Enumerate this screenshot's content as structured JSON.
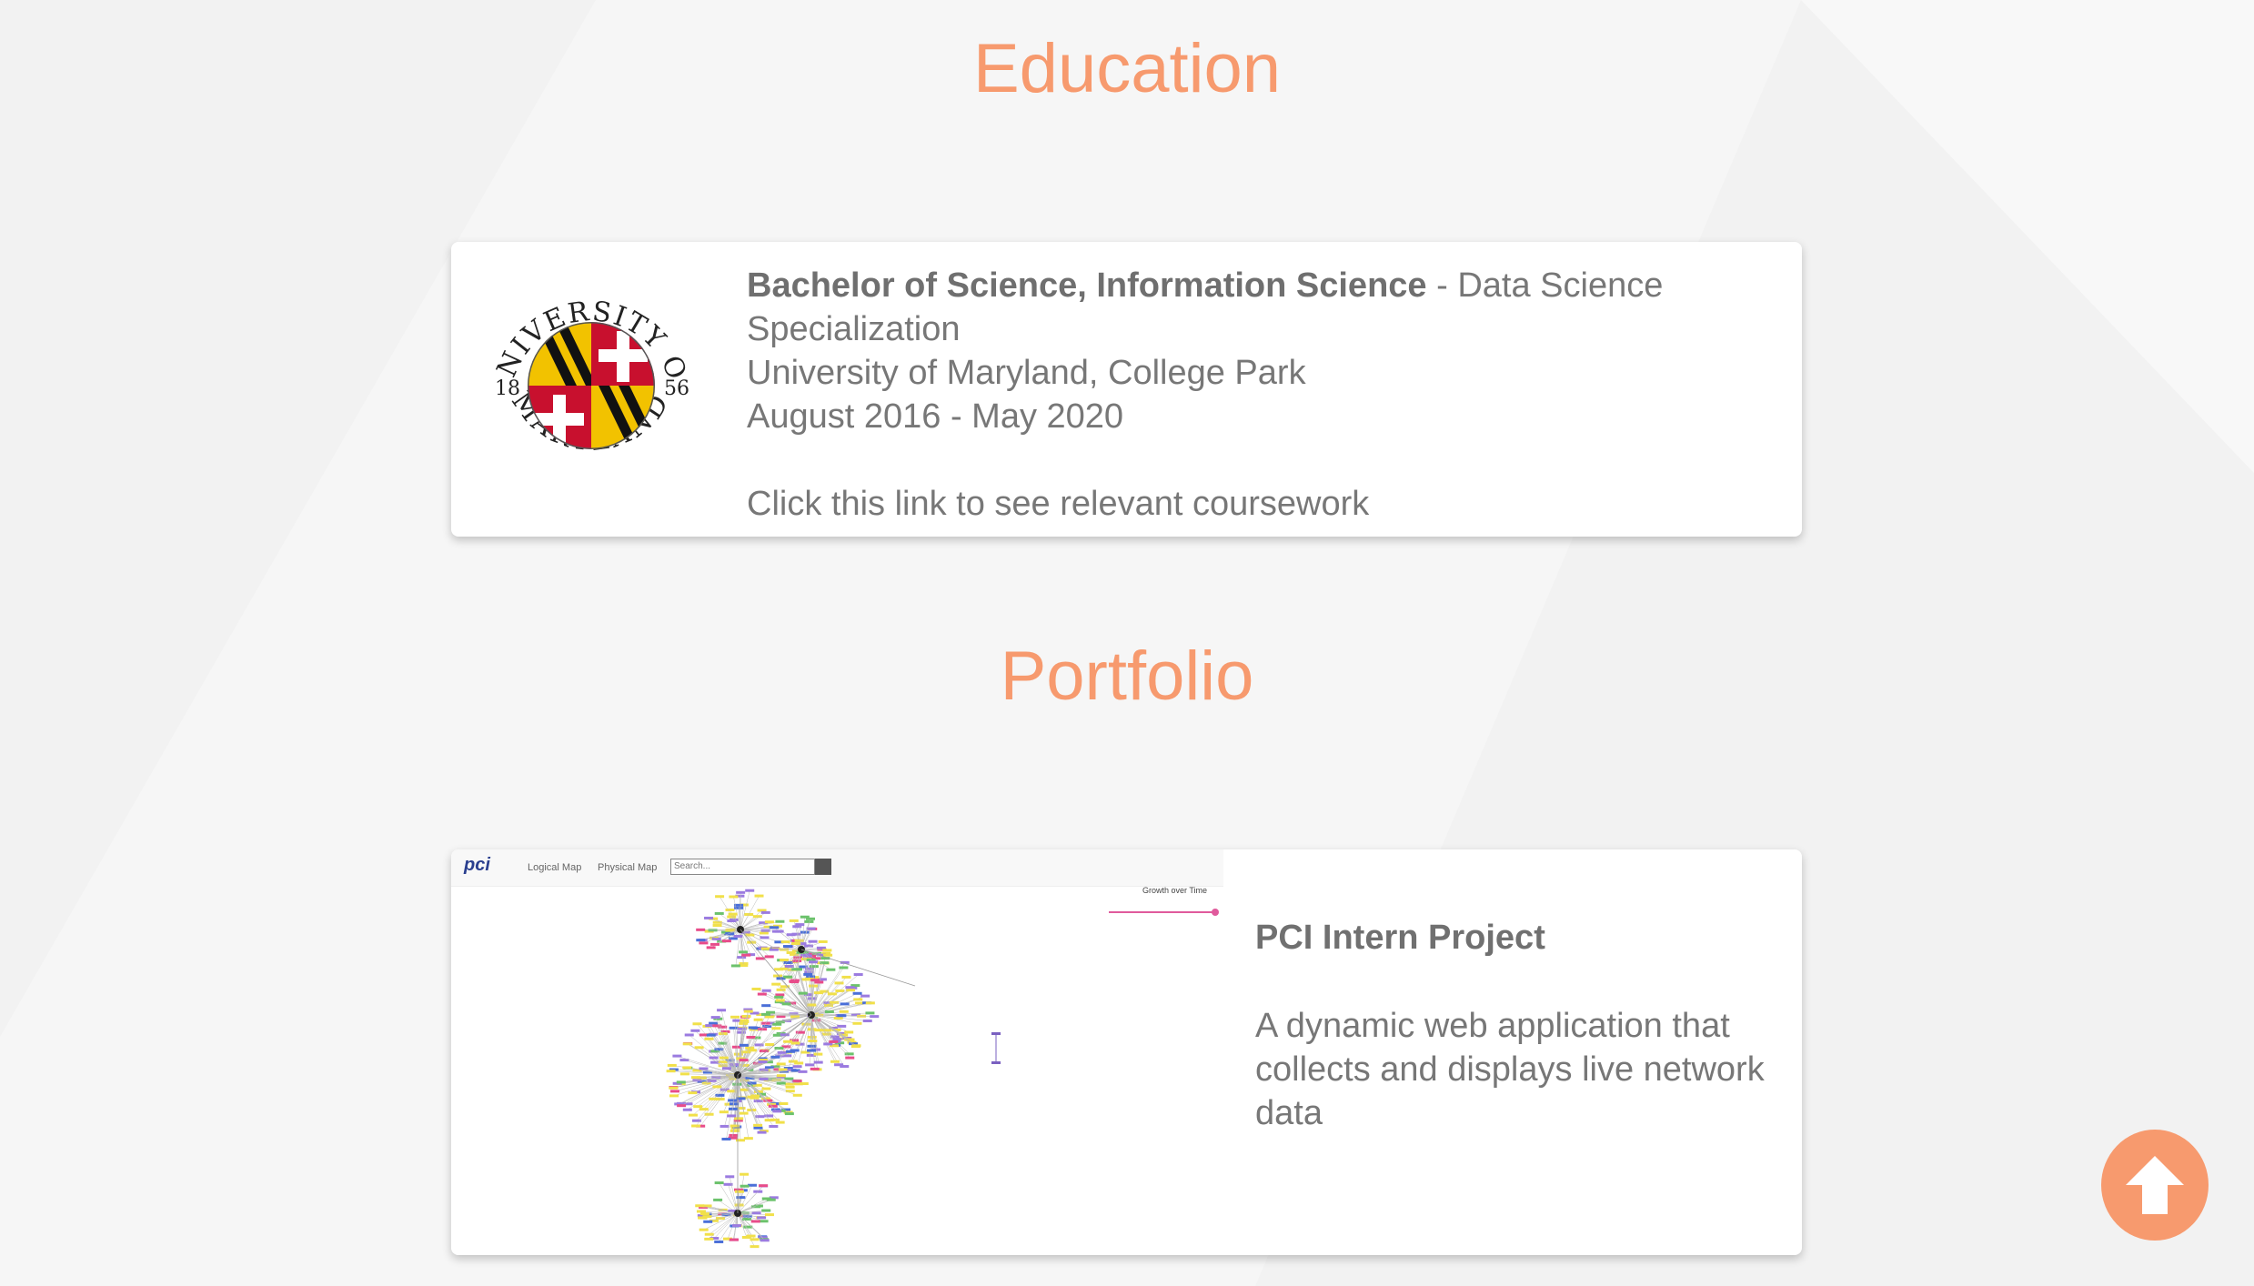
{
  "education": {
    "heading": "Education",
    "degree": "Bachelor of Science, Information Science",
    "specialization": " - Data Science Specialization",
    "school": "University of Maryland, College Park",
    "dates": "August 2016 - May 2020",
    "coursework_link": "Click this link to see relevant coursework",
    "logo": {
      "top_text": "UNIVERSITY OF",
      "bottom_text": "MARYLAND",
      "year_left": "18",
      "year_right": "56"
    }
  },
  "portfolio": {
    "heading": "Portfolio",
    "project_title": "PCI Intern Project",
    "project_description": "A dynamic web application that collects and displays live network data",
    "screenshot": {
      "brand": "pci",
      "nav_logical": "Logical Map",
      "nav_physical": "Physical Map",
      "search_placeholder": "Search...",
      "chart_label": "Growth over Time"
    }
  },
  "scroll_top": {
    "icon": "arrow-up-icon"
  },
  "colors": {
    "accent": "#f79a6e",
    "text": "#777777",
    "card": "#ffffff",
    "background": "#f3f3f3"
  }
}
